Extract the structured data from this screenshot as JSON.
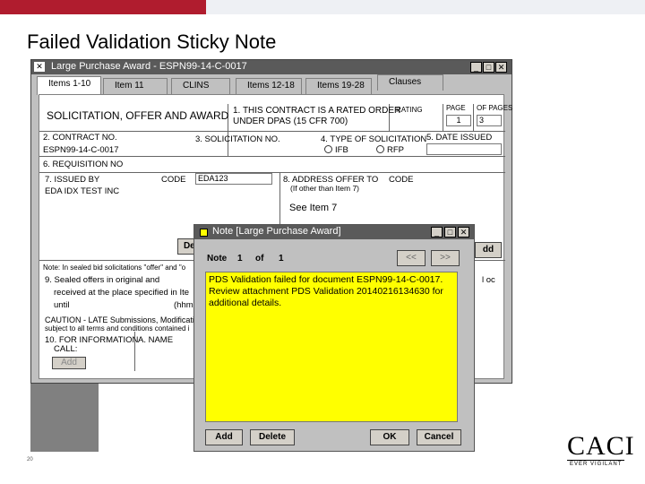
{
  "slide": {
    "title": "Failed Validation Sticky Note",
    "footer_page": "20"
  },
  "window": {
    "title": "Large Purchase Award - ESPN99-14-C-0017",
    "tabs": [
      "Items 1-10",
      "Item 11",
      "CLINS",
      "Items 12-18",
      "Items 19-28",
      "Clauses"
    ],
    "active_tab": 0
  },
  "form": {
    "header": "SOLICITATION, OFFER AND AWARD",
    "rated_order": "1. THIS CONTRACT IS A RATED ORDER",
    "under_dpas": "UNDER DPAS (15 CFR 700)",
    "rating_label": "RATING",
    "page_label": "PAGE",
    "of_pages_label": "OF PAGES",
    "page_value": "1",
    "of_pages_value": "3",
    "contract_no_label": "2. CONTRACT NO.",
    "contract_no_value": "ESPN99-14-C-0017",
    "solicitation_no_label": "3. SOLICITATION NO.",
    "type_label": "4. TYPE OF SOLICITATION",
    "ifb": "IFB",
    "rfp": "RFP",
    "date_issued_label": "5. DATE ISSUED",
    "requisition_label": "6. REQUISITION NO",
    "issued_by_label": "7. ISSUED BY",
    "code_label": "CODE",
    "code_value": "EDA123",
    "issued_by_value": "EDA IDX TEST INC",
    "address_offer_label": "8. ADDRESS OFFER TO",
    "address_offer_sub": "(If other than Item 7)",
    "code_label2": "CODE",
    "see_item": "See Item 7",
    "det_button": "Det",
    "add_button_right": "dd",
    "note_sealed": "Note: In sealed bid solicitations \"offer\" and \"o",
    "sealed_offers": "9. Sealed offers in original and",
    "received_at": "received at the place specified in Ite",
    "until": "until",
    "hmm": "(hhmm",
    "caution": "CAUTION - LATE Submissions, Modifications",
    "subject": "subject to all terms and conditions contained i",
    "for_info": "10. FOR INFORMATION",
    "a_name": "A. NAME",
    "call": "CALL:",
    "add_bottom": "Add",
    "loc": "l oc"
  },
  "note": {
    "title": "Note [Large Purchase Award]",
    "note_label": "Note",
    "current": "1",
    "of": "of",
    "total": "1",
    "prev": "<<",
    "next": ">>",
    "text": "PDS Validation failed for document ESPN99-14-C-0017.  Review attachment PDS Validation 20140216134630 for additional details.",
    "add": "Add",
    "delete": "Delete",
    "ok": "OK",
    "cancel": "Cancel"
  },
  "brand": {
    "logo": "CACI",
    "tagline": "EVER VIGILANT"
  },
  "colors": {
    "note_yellow": "#ffff00",
    "titlebar": "#5a5a5a",
    "accent_bar": "#c0392b"
  }
}
